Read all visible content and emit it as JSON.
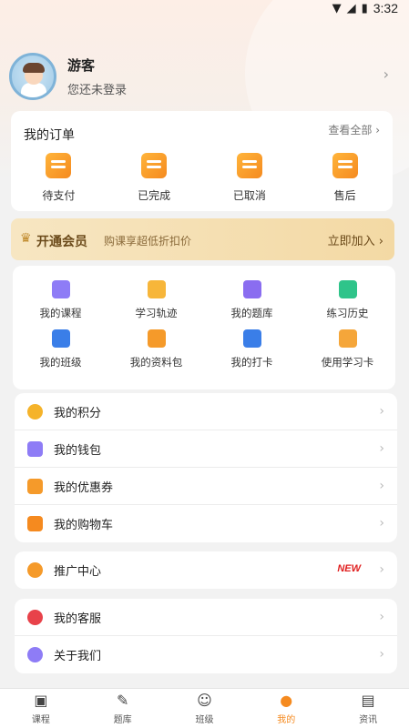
{
  "status_bar": {
    "time": "3:32"
  },
  "profile": {
    "name": "游客",
    "subtitle": "您还未登录"
  },
  "orders": {
    "title": "我的订单",
    "view_all": "查看全部 ›",
    "items": [
      {
        "label": "待支付",
        "icon": "wallet-icon"
      },
      {
        "label": "已完成",
        "icon": "order-done-icon"
      },
      {
        "label": "已取消",
        "icon": "order-cancel-icon"
      },
      {
        "label": "售后",
        "icon": "after-sale-icon"
      }
    ]
  },
  "vip": {
    "title": "开通会员",
    "subtitle": "购课享超低折扣价",
    "join": "立即加入 ›"
  },
  "grid": {
    "row1": [
      {
        "label": "我的课程",
        "icon": "course-icon",
        "color": "#8e7cf6"
      },
      {
        "label": "学习轨迹",
        "icon": "track-icon",
        "color": "#f7b63a"
      },
      {
        "label": "我的题库",
        "icon": "question-bank-icon",
        "color": "#8a6df0"
      },
      {
        "label": "练习历史",
        "icon": "history-icon",
        "color": "#2fc48a"
      }
    ],
    "row2": [
      {
        "label": "我的班级",
        "icon": "class-icon",
        "color": "#3a7ee8"
      },
      {
        "label": "我的资料包",
        "icon": "folder-icon",
        "color": "#f59a2a"
      },
      {
        "label": "我的打卡",
        "icon": "checkin-icon",
        "color": "#3a7ee8"
      },
      {
        "label": "使用学习卡",
        "icon": "study-card-icon",
        "color": "#f5a63a"
      }
    ]
  },
  "list1": [
    {
      "label": "我的积分",
      "icon": "points-icon",
      "color": "#f5b32a"
    },
    {
      "label": "我的钱包",
      "icon": "wallet2-icon",
      "color": "#8e7cf6"
    },
    {
      "label": "我的优惠券",
      "icon": "coupon-icon",
      "color": "#f59a2a"
    },
    {
      "label": "我的购物车",
      "icon": "cart-icon",
      "color": "#f58a1f"
    }
  ],
  "promo": {
    "label": "推广中心",
    "badge": "NEW"
  },
  "list3": [
    {
      "label": "我的客服",
      "icon": "heart-icon",
      "color": "#e8424a"
    },
    {
      "label": "关于我们",
      "icon": "about-icon",
      "color": "#8e7cf6"
    }
  ],
  "tabs": [
    {
      "label": "课程",
      "icon": "tv-icon"
    },
    {
      "label": "题库",
      "icon": "pen-icon"
    },
    {
      "label": "班级",
      "icon": "people-icon"
    },
    {
      "label": "我的",
      "icon": "user-icon",
      "active": true
    },
    {
      "label": "资讯",
      "icon": "news-icon"
    }
  ]
}
